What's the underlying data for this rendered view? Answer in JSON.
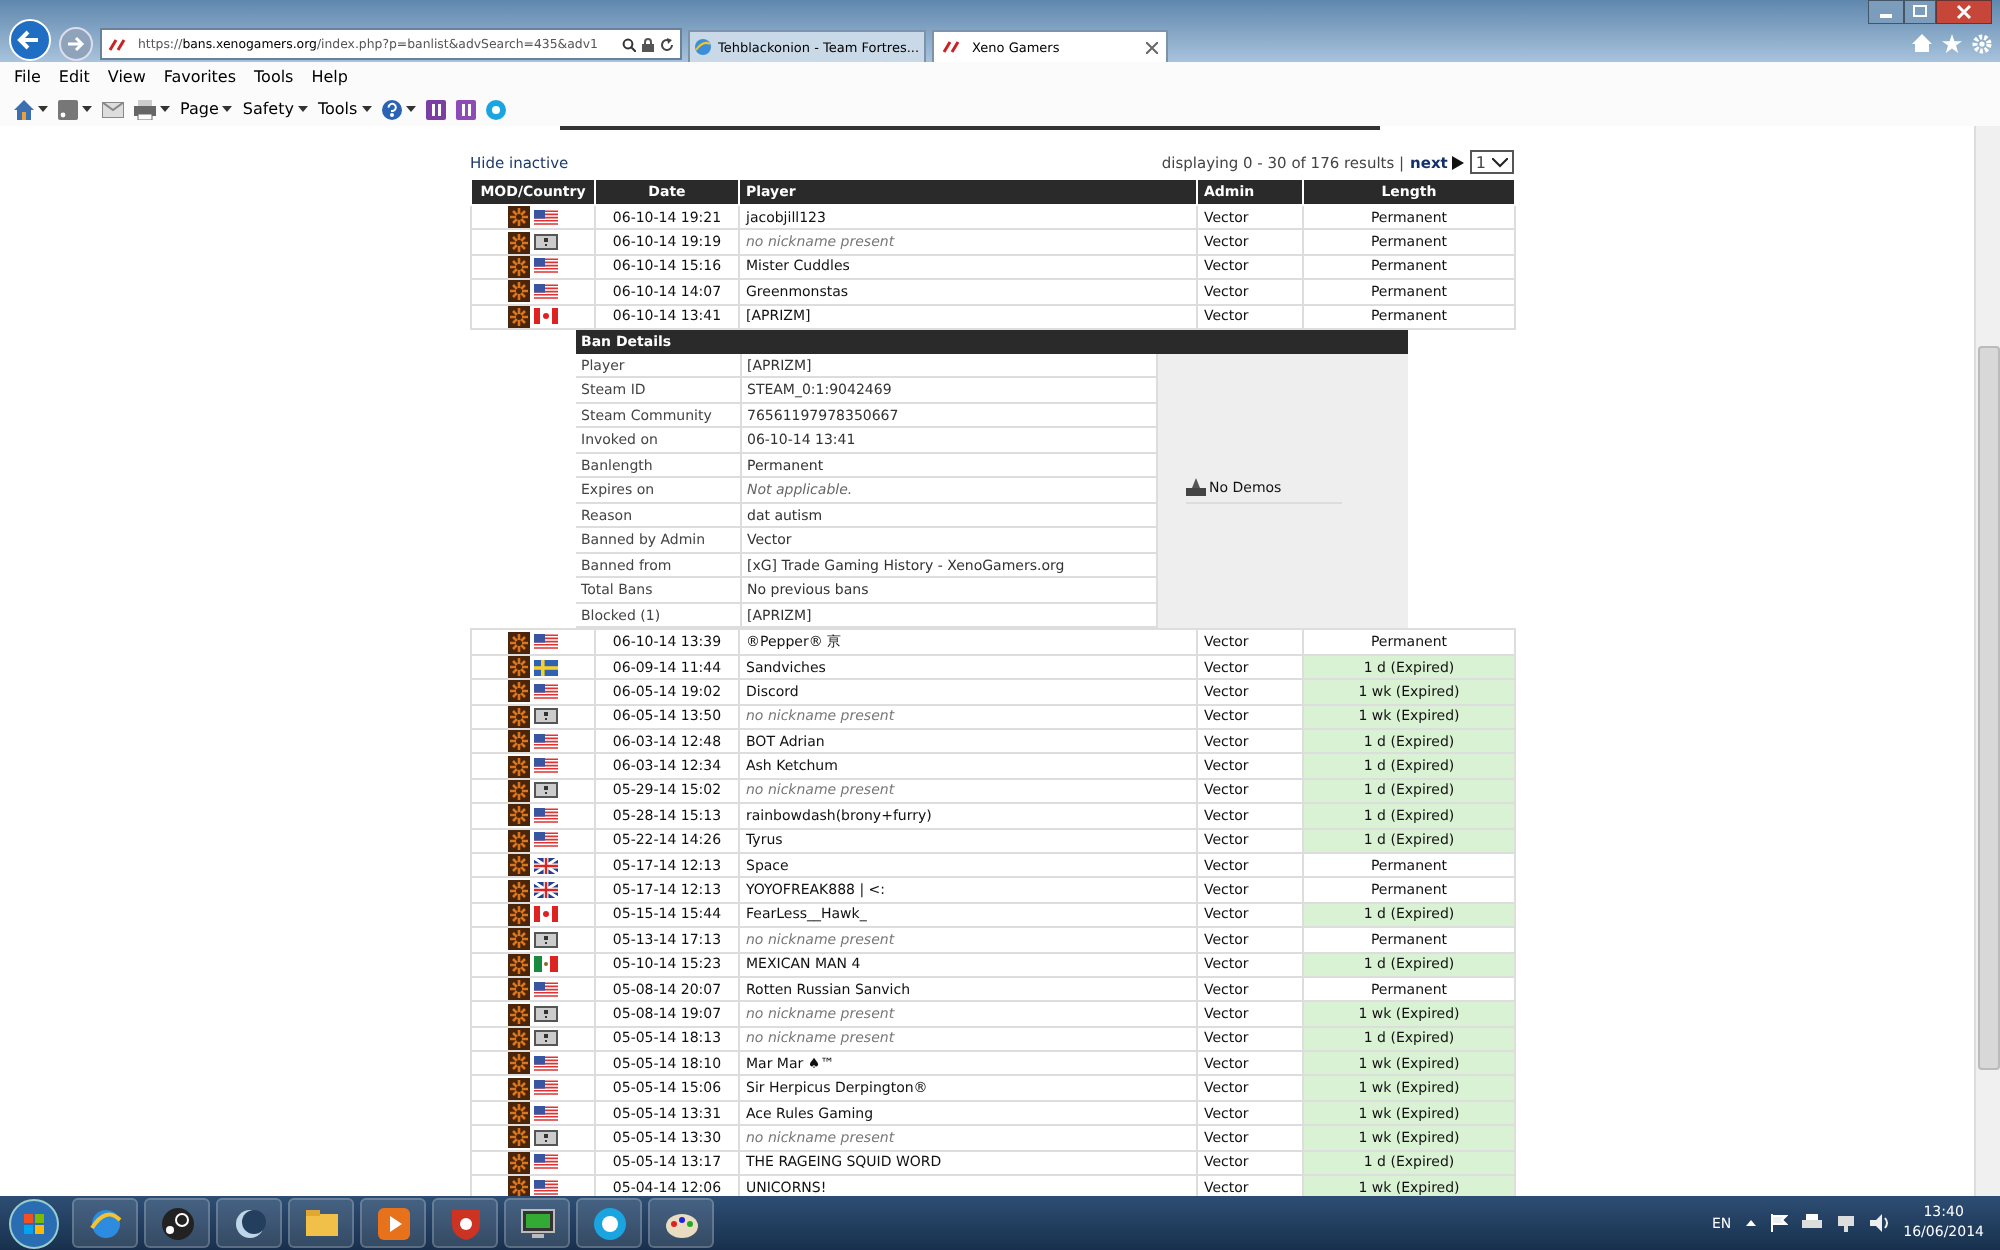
{
  "browser": {
    "address": "https://**bans.xenogamers.org**/index.php?p=banlist&advSearch=435&adv1",
    "tabs": [
      {
        "label": "Tehblackonion - Team Fortres...",
        "selected": false
      },
      {
        "label": "Xeno Gamers",
        "selected": true
      }
    ],
    "menu": [
      "File",
      "Edit",
      "View",
      "Favorites",
      "Tools",
      "Help"
    ],
    "commands": [
      "Page",
      "Safety",
      "Tools"
    ]
  },
  "page": {
    "hide_inactive": "Hide inactive",
    "pagination": "displaying 0 - 30 of 176 results |",
    "next": "next",
    "page_select": "1"
  },
  "table": {
    "columns": [
      "MOD/Country",
      "Date",
      "Player",
      "Admin",
      "Length"
    ],
    "rows": [
      {
        "kind": "ban",
        "flag": {
          "kind": "us"
        },
        "date": "06-10-14 19:21",
        "player": "jacobjill123",
        "nickname": true,
        "admin": "Vector",
        "length": "Permanent",
        "expired": false
      },
      {
        "kind": "ban",
        "flag": {
          "kind": "unknown"
        },
        "date": "06-10-14 19:19",
        "player": "no nickname present",
        "nickname": false,
        "admin": "Vector",
        "length": "Permanent",
        "expired": false
      },
      {
        "kind": "ban",
        "flag": {
          "kind": "us"
        },
        "date": "06-10-14 15:16",
        "player": "Mister Cuddles",
        "nickname": true,
        "admin": "Vector",
        "length": "Permanent",
        "expired": false
      },
      {
        "kind": "ban",
        "flag": {
          "kind": "us"
        },
        "date": "06-10-14 14:07",
        "player": "Greenmonstas",
        "nickname": true,
        "admin": "Vector",
        "length": "Permanent",
        "expired": false
      },
      {
        "kind": "ban",
        "flag": {
          "kind": "ca"
        },
        "date": "06-10-14 13:41",
        "player": "[APRIZM]",
        "nickname": true,
        "admin": "Vector",
        "length": "Permanent",
        "expired": false
      },
      {
        "kind": "details",
        "title": "Ban Details",
        "demos": "No Demos",
        "fields": [
          {
            "label": "Player",
            "value": "[APRIZM]",
            "muted": false
          },
          {
            "label": "Steam ID",
            "value": "STEAM_0:1:9042469",
            "muted": false
          },
          {
            "label": "Steam Community",
            "value": "76561197978350667",
            "muted": false
          },
          {
            "label": "Invoked on",
            "value": "06-10-14 13:41",
            "muted": false
          },
          {
            "label": "Banlength",
            "value": "Permanent",
            "muted": false
          },
          {
            "label": "Expires on",
            "value": "Not applicable.",
            "muted": true
          },
          {
            "label": "Reason",
            "value": "dat autism",
            "muted": false
          },
          {
            "label": "Banned by Admin",
            "value": "Vector",
            "muted": false
          },
          {
            "label": "Banned from",
            "value": "[xG] Trade Gaming History - XenoGamers.org",
            "muted": false
          },
          {
            "label": "Total Bans",
            "value": "No previous bans",
            "muted": false
          },
          {
            "label": "Blocked (1)",
            "value": "[APRIZM]",
            "muted": false
          }
        ]
      },
      {
        "kind": "ban",
        "flag": {
          "kind": "us"
        },
        "date": "06-10-14 13:39",
        "player": "®Pepper® 亰",
        "nickname": true,
        "admin": "Vector",
        "length": "Permanent",
        "expired": false
      },
      {
        "kind": "ban",
        "flag": {
          "kind": "se"
        },
        "date": "06-09-14 11:44",
        "player": "Sandviches",
        "nickname": true,
        "admin": "Vector",
        "length": "1 d (Expired)",
        "expired": true
      },
      {
        "kind": "ban",
        "flag": {
          "kind": "us"
        },
        "date": "06-05-14 19:02",
        "player": "Discord",
        "nickname": true,
        "admin": "Vector",
        "length": "1 wk (Expired)",
        "expired": true
      },
      {
        "kind": "ban",
        "flag": {
          "kind": "unknown"
        },
        "date": "06-05-14 13:50",
        "player": "no nickname present",
        "nickname": false,
        "admin": "Vector",
        "length": "1 wk (Expired)",
        "expired": true
      },
      {
        "kind": "ban",
        "flag": {
          "kind": "us"
        },
        "date": "06-03-14 12:48",
        "player": "BOT Adrian",
        "nickname": true,
        "admin": "Vector",
        "length": "1 d (Expired)",
        "expired": true
      },
      {
        "kind": "ban",
        "flag": {
          "kind": "us"
        },
        "date": "06-03-14 12:34",
        "player": "Ash Ketchum",
        "nickname": true,
        "admin": "Vector",
        "length": "1 d (Expired)",
        "expired": true
      },
      {
        "kind": "ban",
        "flag": {
          "kind": "unknown"
        },
        "date": "05-29-14 15:02",
        "player": "no nickname present",
        "nickname": false,
        "admin": "Vector",
        "length": "1 d (Expired)",
        "expired": true
      },
      {
        "kind": "ban",
        "flag": {
          "kind": "us"
        },
        "date": "05-28-14 15:13",
        "player": "rainbowdash(brony+furry)",
        "nickname": true,
        "admin": "Vector",
        "length": "1 d (Expired)",
        "expired": true
      },
      {
        "kind": "ban",
        "flag": {
          "kind": "us"
        },
        "date": "05-22-14 14:26",
        "player": "Tyrus",
        "nickname": true,
        "admin": "Vector",
        "length": "1 d (Expired)",
        "expired": true
      },
      {
        "kind": "ban",
        "flag": {
          "kind": "gb"
        },
        "date": "05-17-14 12:13",
        "player": "Space",
        "nickname": true,
        "admin": "Vector",
        "length": "Permanent",
        "expired": false
      },
      {
        "kind": "ban",
        "flag": {
          "kind": "gb"
        },
        "date": "05-17-14 12:13",
        "player": "YOYOFREAK888 | <:",
        "nickname": true,
        "admin": "Vector",
        "length": "Permanent",
        "expired": false
      },
      {
        "kind": "ban",
        "flag": {
          "kind": "ca"
        },
        "date": "05-15-14 15:44",
        "player": "FearLess__Hawk_",
        "nickname": true,
        "admin": "Vector",
        "length": "1 d (Expired)",
        "expired": true
      },
      {
        "kind": "ban",
        "flag": {
          "kind": "unknown"
        },
        "date": "05-13-14 17:13",
        "player": "no nickname present",
        "nickname": false,
        "admin": "Vector",
        "length": "Permanent",
        "expired": false
      },
      {
        "kind": "ban",
        "flag": {
          "kind": "mx"
        },
        "date": "05-10-14 15:23",
        "player": "MEXICAN MAN 4",
        "nickname": true,
        "admin": "Vector",
        "length": "1 d (Expired)",
        "expired": true
      },
      {
        "kind": "ban",
        "flag": {
          "kind": "us"
        },
        "date": "05-08-14 20:07",
        "player": "Rotten Russian Sanvich",
        "nickname": true,
        "admin": "Vector",
        "length": "Permanent",
        "expired": false
      },
      {
        "kind": "ban",
        "flag": {
          "kind": "unknown"
        },
        "date": "05-08-14 19:07",
        "player": "no nickname present",
        "nickname": false,
        "admin": "Vector",
        "length": "1 wk (Expired)",
        "expired": true
      },
      {
        "kind": "ban",
        "flag": {
          "kind": "unknown"
        },
        "date": "05-05-14 18:13",
        "player": "no nickname present",
        "nickname": false,
        "admin": "Vector",
        "length": "1 d (Expired)",
        "expired": true
      },
      {
        "kind": "ban",
        "flag": {
          "kind": "us"
        },
        "date": "05-05-14 18:10",
        "player": "Mar Mar ♠™",
        "nickname": true,
        "admin": "Vector",
        "length": "1 wk (Expired)",
        "expired": true
      },
      {
        "kind": "ban",
        "flag": {
          "kind": "us"
        },
        "date": "05-05-14 15:06",
        "player": "Sir Herpicus Derpington®",
        "nickname": true,
        "admin": "Vector",
        "length": "1 wk (Expired)",
        "expired": true
      },
      {
        "kind": "ban",
        "flag": {
          "kind": "us"
        },
        "date": "05-05-14 13:31",
        "player": "Ace Rules Gaming",
        "nickname": true,
        "admin": "Vector",
        "length": "1 wk (Expired)",
        "expired": true
      },
      {
        "kind": "ban",
        "flag": {
          "kind": "unknown"
        },
        "date": "05-05-14 13:30",
        "player": "no nickname present",
        "nickname": false,
        "admin": "Vector",
        "length": "1 wk (Expired)",
        "expired": true
      },
      {
        "kind": "ban",
        "flag": {
          "kind": "us"
        },
        "date": "05-05-14 13:17",
        "player": "THE RAGEING SQUID WORD",
        "nickname": true,
        "admin": "Vector",
        "length": "1 d (Expired)",
        "expired": true
      },
      {
        "kind": "ban",
        "flag": {
          "kind": "us"
        },
        "date": "05-04-14 12:06",
        "player": "UNICORNS!",
        "nickname": true,
        "admin": "Vector",
        "length": "1 wk (Expired)",
        "expired": true
      }
    ]
  },
  "taskbar": {
    "language": "EN",
    "time": "13:40",
    "date": "16/06/2014"
  }
}
